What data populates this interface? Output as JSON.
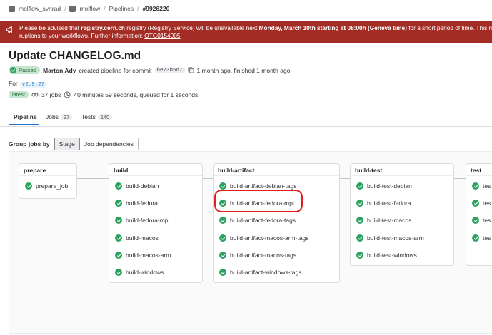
{
  "breadcrumbs": [
    "molflow_synrad",
    "molflow",
    "Pipelines",
    "#9926220"
  ],
  "banner": {
    "line1_a": "Please be advised that ",
    "line1_b": "registry.cern.ch",
    "line1_c": " registry (Registry Service) will be unavailable next ",
    "line1_d": "Monday, March 10th starting at 08:00h (Geneva time)",
    "line1_e": " for a short period of time. This ma",
    "line2_a": "ruptions to your workflows. Further information: ",
    "link": "OTG0154905"
  },
  "title": "Update CHANGELOG.md",
  "meta": {
    "status": "Passed",
    "author": "Marton Ady",
    "created_text": "created pipeline for commit",
    "sha": "be73b5d7",
    "time_text": "1 month ago, finished 1 month ago"
  },
  "for_label": "For",
  "ref": "v2.9.27",
  "stats": {
    "latest": "latest",
    "jobs": "37 jobs",
    "duration": "40 minutes 59 seconds, queued for 1 seconds"
  },
  "tabs": [
    {
      "label": "Pipeline"
    },
    {
      "label": "Jobs",
      "count": "37"
    },
    {
      "label": "Tests",
      "count": "140"
    }
  ],
  "group_by": {
    "label": "Group jobs by",
    "options": [
      "Stage",
      "Job dependencies"
    ],
    "selected": "Stage"
  },
  "stages": [
    {
      "name": "prepare",
      "jobs": [
        "prepare_job"
      ]
    },
    {
      "name": "build",
      "jobs": [
        "build-debian",
        "build-fedora",
        "build-fedora-mpi",
        "build-macos",
        "build-macos-arm",
        "build-windows"
      ]
    },
    {
      "name": "build-artifact",
      "jobs": [
        "build-artifact-debian-tags",
        "build-artifact-fedora-mpi",
        "build-artifact-fedora-tags",
        "build-artifact-macos-arm-tags",
        "build-artifact-macos-tags",
        "build-artifact-windows-tags"
      ]
    },
    {
      "name": "build-test",
      "jobs": [
        "build-test-debian",
        "build-test-fedora",
        "build-test-macos",
        "build-test-macos-arm",
        "build-test-windows"
      ]
    },
    {
      "name": "test",
      "jobs": [
        "tes",
        "tes",
        "tes",
        "tes"
      ]
    }
  ],
  "colors": {
    "success": "#2da160",
    "banner": "#a32d25",
    "highlight": "#e02020",
    "accent": "#1f75cb"
  }
}
